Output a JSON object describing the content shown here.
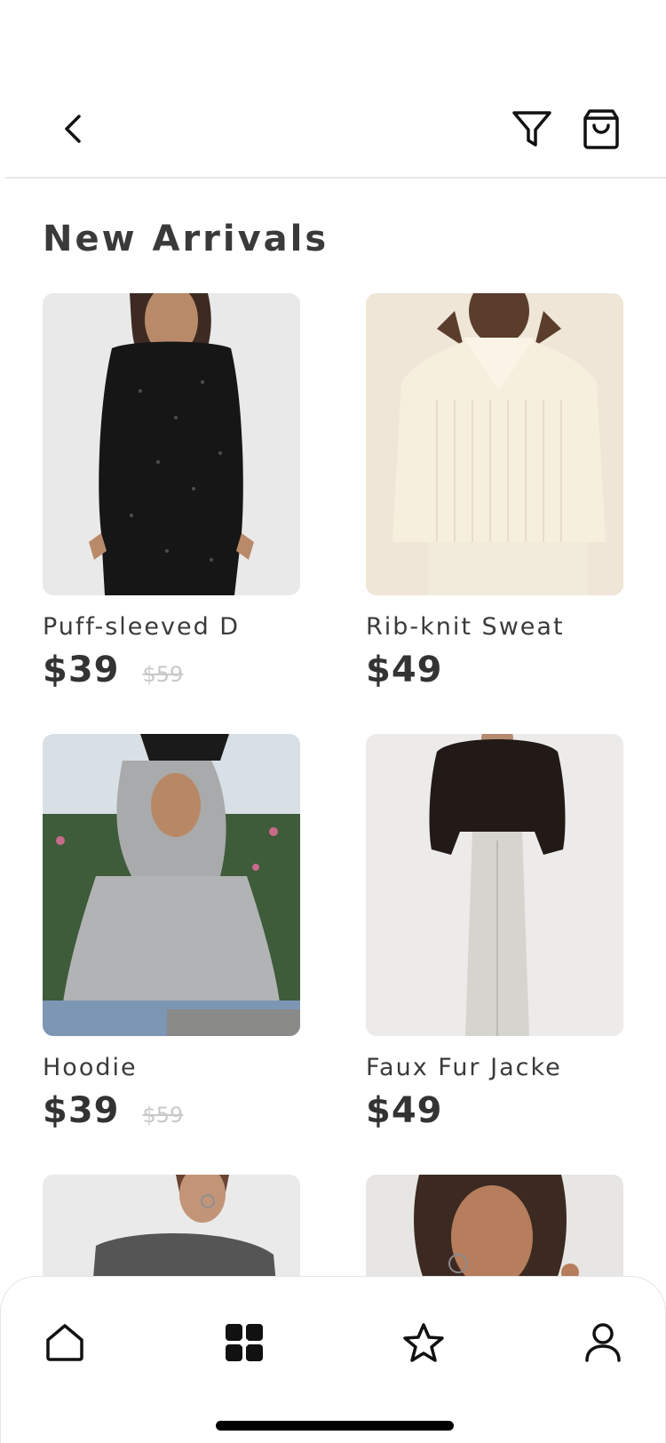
{
  "header": {
    "back_icon": "chevron-left-icon",
    "filter_icon": "filter-icon",
    "bag_icon": "shopping-bag-icon"
  },
  "page": {
    "title": "New Arrivals"
  },
  "products": [
    {
      "name": "Puff-sleeved D",
      "price": "$39",
      "old_price": "$59",
      "image": "black sequin dress"
    },
    {
      "name": "Rib-knit Sweat",
      "price": "$49",
      "old_price": "",
      "image": "cream rib-knit sweater"
    },
    {
      "name": "Hoodie",
      "price": "$39",
      "old_price": "$59",
      "image": "grey hoodie"
    },
    {
      "name": "Faux Fur Jacke",
      "price": "$49",
      "old_price": "",
      "image": "black faux fur jacket"
    },
    {
      "name": "",
      "price": "",
      "old_price": "",
      "image": "grey off-shoulder knit"
    },
    {
      "name": "",
      "price": "",
      "old_price": "",
      "image": "portrait with earrings"
    }
  ],
  "bottom_nav": {
    "items": [
      {
        "icon": "home-icon"
      },
      {
        "icon": "grid-icon",
        "active": true
      },
      {
        "icon": "star-icon"
      },
      {
        "icon": "user-icon"
      }
    ]
  },
  "colors": {
    "accent": "#000000",
    "text": "#333333",
    "muted": "#c8c8c8"
  }
}
